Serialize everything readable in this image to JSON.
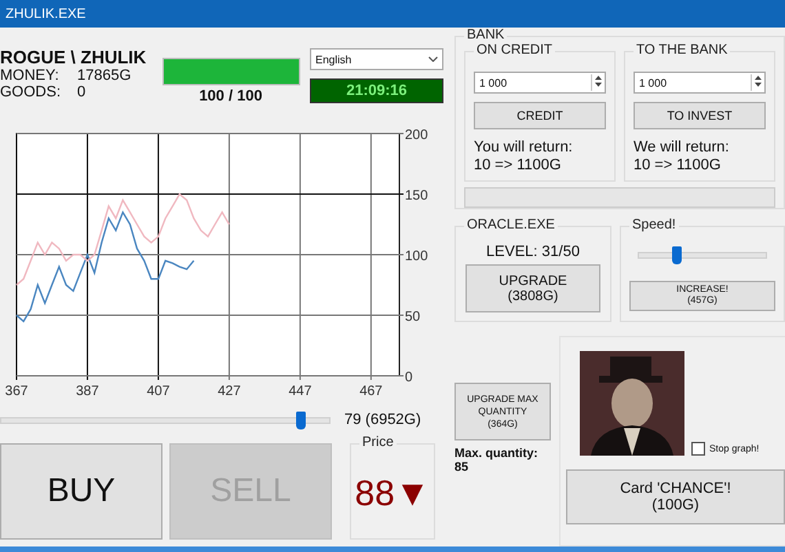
{
  "window": {
    "title": "ZHULIK.EXE"
  },
  "player": {
    "name": "ROGUE \\ ZHULIK",
    "money_label": "MONEY:",
    "money": "17865G",
    "goods_label": "GOODS:",
    "goods": "0"
  },
  "health": {
    "level": 1,
    "reading": "100 / 100"
  },
  "language": {
    "value": "English"
  },
  "clock": "21:09:16",
  "chart": {
    "chart_data": {
      "type": "line",
      "x": [
        367,
        369,
        371,
        373,
        375,
        377,
        379,
        381,
        383,
        385,
        387,
        389,
        391,
        393,
        395,
        397,
        399,
        401,
        403,
        405,
        407,
        409,
        411,
        413,
        415,
        417,
        419,
        421,
        423,
        425,
        427
      ],
      "series": [
        {
          "color": "#4a86c0",
          "values": [
            50,
            45,
            55,
            75,
            60,
            75,
            90,
            75,
            70,
            85,
            100,
            85,
            110,
            130,
            120,
            135,
            125,
            105,
            95,
            80,
            80,
            95,
            93,
            90,
            88,
            95,
            null,
            null,
            null,
            null,
            null
          ]
        },
        {
          "color": "#f0b8c0",
          "values": [
            75,
            80,
            95,
            110,
            100,
            110,
            105,
            95,
            100,
            100,
            95,
            100,
            120,
            140,
            130,
            145,
            135,
            125,
            115,
            110,
            115,
            130,
            140,
            150,
            145,
            130,
            120,
            115,
            125,
            135,
            125
          ]
        }
      ],
      "grid": true,
      "xlim": [
        367,
        475
      ],
      "ylim": [
        0,
        200
      ],
      "xticks": [
        367,
        387,
        407,
        427,
        447,
        467
      ],
      "yticks": [
        0,
        50,
        100,
        150,
        200
      ]
    }
  },
  "quantity": {
    "level": 0.91,
    "reading": "79 (6952G)"
  },
  "buy_button": {
    "label": "BUY",
    "disabled": false
  },
  "sell_button": {
    "label": "SELL",
    "disabled": true
  },
  "price": {
    "title": "Price",
    "value": "88",
    "arrow": "▼"
  },
  "bank": {
    "title": "BANK",
    "sections": [
      {
        "title": "ON CREDIT",
        "amount": "1 000",
        "button": "CREDIT",
        "note": "You will return:",
        "terms": "10 => 1100G"
      },
      {
        "title": "TO THE BANK",
        "amount": "1 000",
        "button": "TO INVEST",
        "note": "We will return:",
        "terms": "10 => 1100G"
      }
    ],
    "progress": {
      "level": 0
    }
  },
  "oracle": {
    "title": "ORACLE.EXE",
    "level_text": "LEVEL: 31/50",
    "button": "UPGRADE",
    "cost": "(3808G)"
  },
  "speed": {
    "title": "Speed!",
    "level": 0.3,
    "button": "INCREASE!",
    "cost": "(457G)"
  },
  "max_quantity": {
    "button": "UPGRADE MAX QUANTITY",
    "cost": "(364G)",
    "label": "Max. quantity:",
    "value": "85"
  },
  "stop_graph": {
    "label": "Stop graph!",
    "checked": false
  },
  "chance_card": {
    "label": "Card 'CHANCE'!",
    "cost": "(100G)"
  }
}
